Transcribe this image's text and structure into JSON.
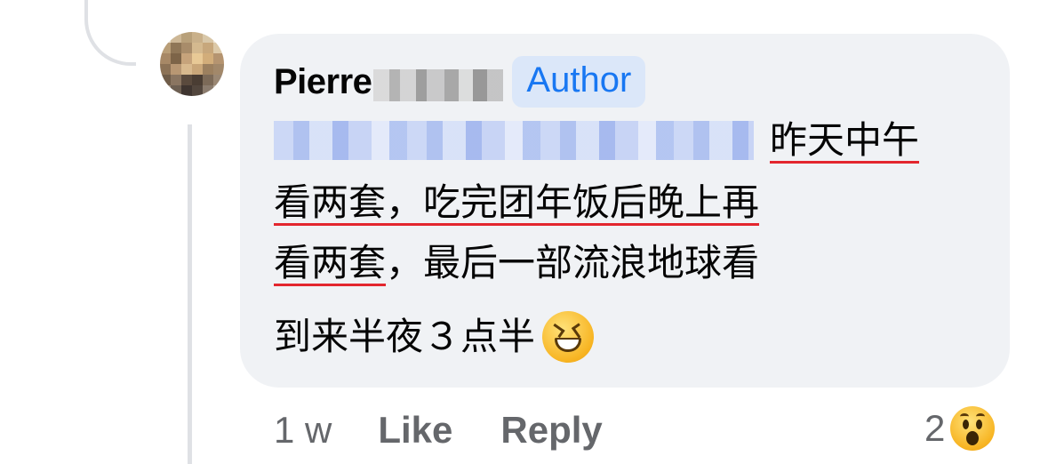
{
  "comment": {
    "author_name": "Pierre",
    "author_badge": "Author",
    "text": {
      "line1_underlined": "昨天中午",
      "line2_underlined": "看两套，吃完团年饭后晚上再",
      "line3_underlined": "看两套",
      "line3_rest": "，最后一部流浪地球看",
      "line4": "到来半夜３点半"
    },
    "emoji_icon": "grinning-squinting-face-icon",
    "timestamp": "1 w",
    "like_label": "Like",
    "reply_label": "Reply",
    "reaction_count": "2",
    "reaction_icon": "wow-reaction-icon"
  },
  "colors": {
    "bubble_background": "#f0f2f5",
    "badge_background": "#dbe7f9",
    "badge_text": "#1877f2",
    "secondary_text": "#65676b",
    "underline": "#e3262e",
    "thread_line": "#dfe1e5"
  }
}
